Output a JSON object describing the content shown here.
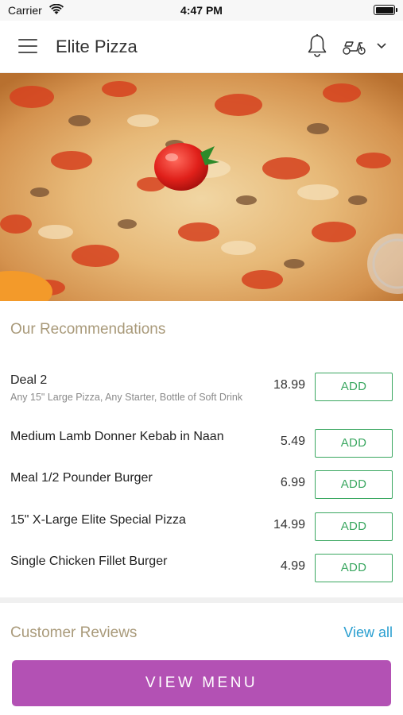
{
  "status_bar": {
    "carrier": "Carrier",
    "time": "4:47 PM"
  },
  "header": {
    "title": "Elite Pizza",
    "icons": [
      "menu-icon",
      "bell-icon",
      "scooter-icon",
      "chevron-down-icon"
    ]
  },
  "recommendations": {
    "title": "Our Recommendations",
    "add_label": "ADD",
    "items": [
      {
        "name": "Deal 2",
        "description": "Any 15\" Large Pizza, Any Starter, Bottle of Soft Drink",
        "price": "18.99"
      },
      {
        "name": "Medium Lamb Donner Kebab in Naan",
        "description": "",
        "price": "5.49"
      },
      {
        "name": "Meal 1/2 Pounder Burger",
        "description": "",
        "price": "6.99"
      },
      {
        "name": "15\" X-Large Elite Special Pizza",
        "description": "",
        "price": "14.99"
      },
      {
        "name": "Single Chicken Fillet Burger",
        "description": "",
        "price": "4.99"
      }
    ]
  },
  "reviews": {
    "title": "Customer Reviews",
    "view_all": "View all"
  },
  "footer": {
    "view_menu": "VIEW MENU"
  },
  "colors": {
    "accent": "#b351b4",
    "add_green": "#3aa760",
    "section_title": "#a99a7a",
    "link": "#2a9fd0"
  }
}
